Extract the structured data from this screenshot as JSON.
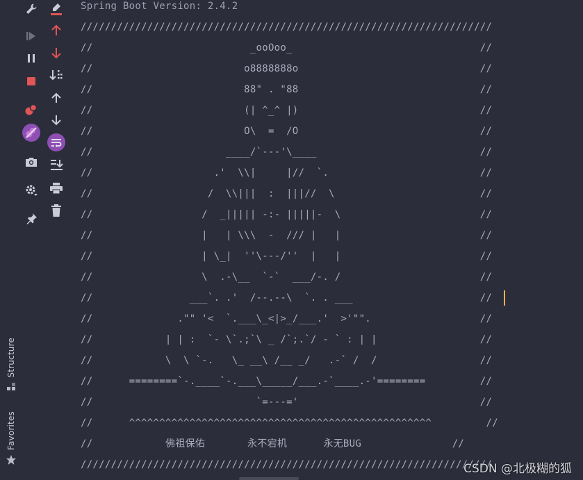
{
  "sidebar": {
    "structure_label": "Structure",
    "favorites_label": "Favorites"
  },
  "colors": {
    "background": "#2b2d3a",
    "console_text": "#a9abbd",
    "red_icon": "#e05555",
    "purple_badge": "#8e4fb5",
    "caret": "#e8b04b"
  },
  "console": {
    "lines": [
      "Spring Boot Version: 2.4.2",
      "////////////////////////////////////////////////////////////////////",
      "//                          _ooOoo_                               //",
      "//                         o8888888o                              //",
      "//                         88\" . \"88                              //",
      "//                         (| ^_^ |)                              //",
      "//                         O\\  =  /O                              //",
      "//                      ____/`---'\\____                           //",
      "//                    .'  \\\\|     |//  `.                         //",
      "//                   /  \\\\|||  :  |||//  \\                        //",
      "//                  /  _||||| -:- |||||-  \\                       //",
      "//                  |   | \\\\\\  -  /// |   |                       //",
      "//                  | \\_|  ''\\---/''  |   |                       //",
      "//                  \\  .-\\__  `-`  ___/-. /                       //",
      "//                ___`. .'  /--.--\\  `. . ___                     //",
      "//              .\"\" '<  `.___\\_<|>_/___.'  >'\"\".                  //",
      "//            | | :  `- \\`.;`\\ _ /`;.`/ - ` : | |                 //",
      "//            \\  \\ `-.   \\_ __\\ /__ _/   .-` /  /                 //",
      "//      ========`-.____`-.___\\_____/___.-`____.-'========         //",
      "//                           `=---='                              //",
      "//      ^^^^^^^^^^^^^^^^^^^^^^^^^^^^^^^^^^^^^^^^^^^^^^^^^^         //",
      "//            佛祖保佑       永不宕机      永无BUG               //",
      "////////////////////////////////////////////////////////////////////"
    ]
  },
  "watermark": "CSDN @北极糊的狐"
}
